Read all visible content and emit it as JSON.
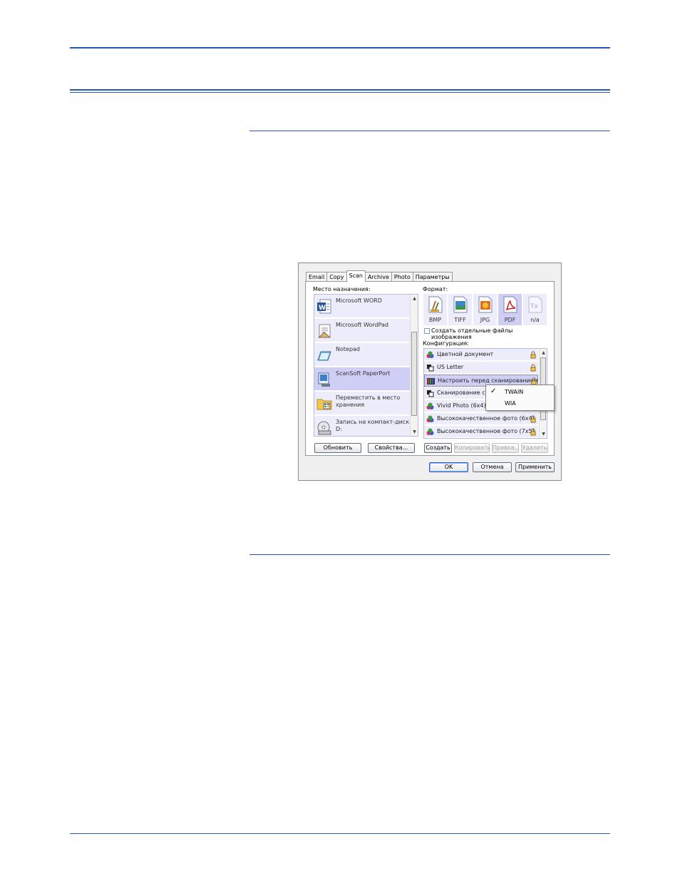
{
  "dialog": {
    "tabs": [
      "Email",
      "Copy",
      "Scan",
      "Archive",
      "Photo",
      "Параметры"
    ],
    "active_tab_index": 2,
    "destination_label": "Место назначения:",
    "destinations": [
      {
        "label": "Microsoft WORD",
        "icon": "word-icon"
      },
      {
        "label": "Microsoft WordPad",
        "icon": "wordpad-icon"
      },
      {
        "label": "Notepad",
        "icon": "notepad-icon"
      },
      {
        "label": "ScanSoft PaperPort",
        "icon": "paperport-icon",
        "selected": true
      },
      {
        "label": "Переместить в место хранения",
        "icon": "folder-icon"
      },
      {
        "label": "Запись на компакт-диск D:",
        "icon": "cd-icon"
      }
    ],
    "format_label": "Формат:",
    "formats": [
      {
        "label": "BMP",
        "icon": "bmp-icon"
      },
      {
        "label": "TIFF",
        "icon": "tiff-icon"
      },
      {
        "label": "JPG",
        "icon": "jpg-icon"
      },
      {
        "label": "PDF",
        "icon": "pdf-icon",
        "selected": true
      },
      {
        "label": "n/a",
        "icon": "text-format-icon"
      }
    ],
    "separate_files_label": "Создать отдельные файлы изображения",
    "config_label": "Конфигурация:",
    "configs": [
      {
        "label": "Цветной документ",
        "icon": "color-doc-icon"
      },
      {
        "label": "US Letter",
        "icon": "bw-doc-icon"
      },
      {
        "label": "Настроить перед сканированием",
        "icon": "configure-icon",
        "selected": true
      },
      {
        "label": "Сканирование сев",
        "icon": "bw-doc-icon"
      },
      {
        "label": "Vivid Photo (6x4)",
        "icon": "color-doc-icon"
      },
      {
        "label": "Высококачественное фото (6x4)",
        "icon": "color-doc-icon"
      },
      {
        "label": "Высококачественное фото (7x5)",
        "icon": "color-doc-icon"
      }
    ],
    "buttons": {
      "refresh": "Обновить",
      "properties": "Свойства...",
      "create": "Создать",
      "copy": "Копировать",
      "edit": "Правка...",
      "delete": "Удалить",
      "ok": "OK",
      "cancel": "Отмена",
      "apply": "Применить"
    },
    "popup_menu": [
      {
        "label": "TWAIN",
        "checked": true
      },
      {
        "label": "WIA",
        "checked": false
      }
    ]
  },
  "colors": {
    "rule": "#2a55b8",
    "item_bg": "#ececfa",
    "item_selected": "#cfcff5"
  }
}
